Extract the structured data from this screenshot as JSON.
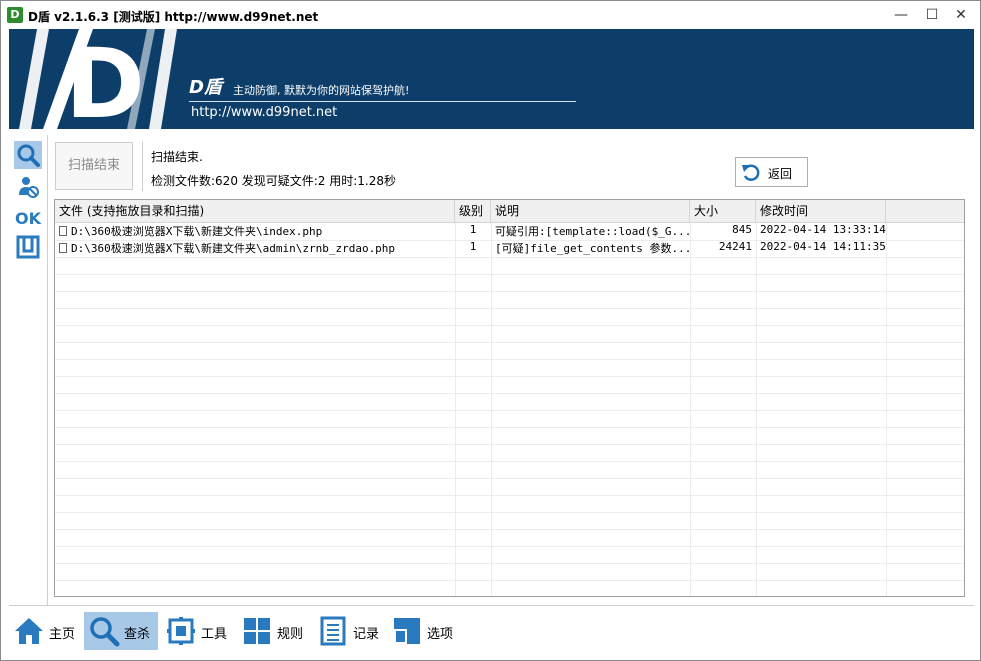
{
  "titlebar": {
    "icon_text": "D",
    "title": "D盾 v2.1.6.3 [测试版] http://www.d99net.net",
    "minimize": "—",
    "maximize": "☐",
    "close": "✕"
  },
  "banner": {
    "logo_letter": "D",
    "brand": "D盾",
    "slogan": "主动防御, 默默为你的网站保驾护航!",
    "url": "http://www.d99net.net",
    "bg_color": "#0d3e6a"
  },
  "sidebar": {
    "items": [
      {
        "icon": "search-icon",
        "active": true
      },
      {
        "icon": "user-shield-icon",
        "active": false
      },
      {
        "icon": "ok-icon",
        "label": "OK",
        "active": false
      },
      {
        "icon": "window-icon",
        "active": false
      }
    ]
  },
  "scan": {
    "button_label": "扫描结束",
    "status": "扫描结束.",
    "stats": "检测文件数:620 发现可疑文件:2 用时:1.28秒",
    "back_label": "返回"
  },
  "table": {
    "columns": [
      "文件 (支持拖放目录和扫描)",
      "级别",
      "说明",
      "大小",
      "修改时间"
    ],
    "rows": [
      {
        "file": "D:\\360极速浏览器X下载\\新建文件夹\\index.php",
        "level": "1",
        "desc": "可疑引用:[template::load($_G...",
        "size": "845",
        "mtime": "2022-04-14 13:33:14"
      },
      {
        "file": "D:\\360极速浏览器X下载\\新建文件夹\\admin\\zrnb_zrdao.php",
        "level": "1",
        "desc": "[可疑]file_get_contents 参数...",
        "size": "24241",
        "mtime": "2022-04-14 14:11:35"
      }
    ]
  },
  "bottom_nav": {
    "items": [
      {
        "label": "主页",
        "icon": "home-icon",
        "active": false
      },
      {
        "label": "查杀",
        "icon": "search-icon",
        "active": true
      },
      {
        "label": "工具",
        "icon": "tools-icon",
        "active": false
      },
      {
        "label": "规则",
        "icon": "grid-icon",
        "active": false
      },
      {
        "label": "记录",
        "icon": "log-icon",
        "active": false
      },
      {
        "label": "选项",
        "icon": "options-icon",
        "active": false
      }
    ]
  },
  "colors": {
    "accent": "#2a7abf",
    "active_bg": "#a8c8e8",
    "banner": "#0d3e6a"
  }
}
